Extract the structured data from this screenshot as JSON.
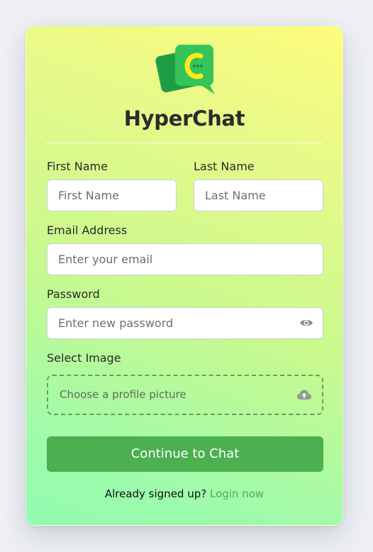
{
  "brand": {
    "name": "HyperChat",
    "logo_letter": "C",
    "logo_icon": "chat-bubble-icon"
  },
  "form": {
    "first_name": {
      "label": "First Name",
      "placeholder": "First Name",
      "value": ""
    },
    "last_name": {
      "label": "Last Name",
      "placeholder": "Last Name",
      "value": ""
    },
    "email": {
      "label": "Email Address",
      "placeholder": "Enter your email",
      "value": ""
    },
    "password": {
      "label": "Password",
      "placeholder": "Enter new password",
      "value": "",
      "toggle_icon": "eye-icon"
    },
    "image": {
      "label": "Select Image",
      "placeholder": "Choose a profile picture",
      "icon": "cloud-upload-icon"
    }
  },
  "submit": {
    "label": "Continue to Chat"
  },
  "footer": {
    "text": "Already signed up?",
    "link": "Login now"
  },
  "colors": {
    "accent": "#4caf50",
    "logo_green": "#2db84b",
    "logo_yellow": "#ffe81a",
    "text": "#2b2b2b"
  }
}
